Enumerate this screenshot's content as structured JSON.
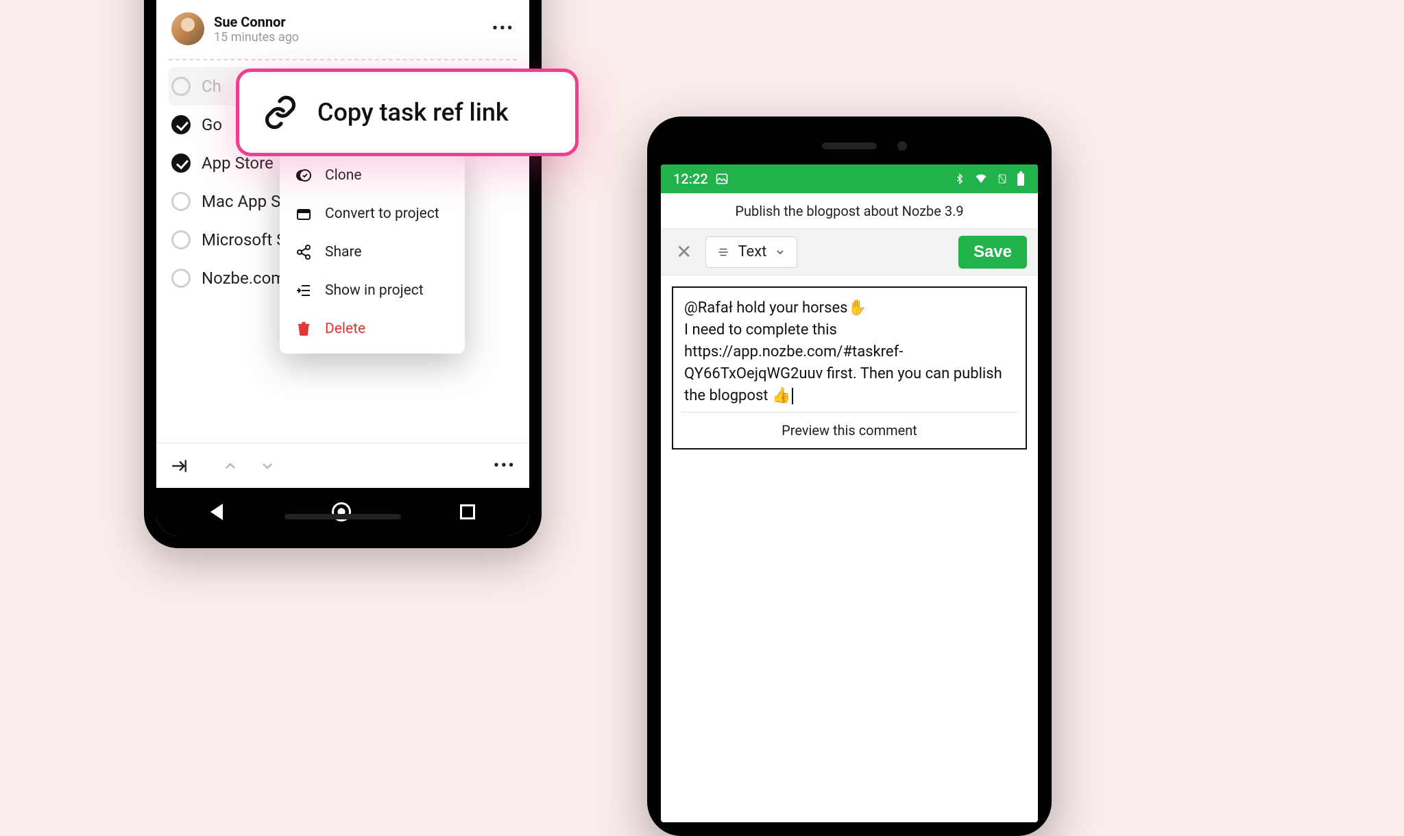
{
  "left": {
    "user": {
      "name": "Sue Connor",
      "time_ago": "15 minutes ago"
    },
    "tasks": [
      {
        "label": "Ch",
        "checked": false,
        "dim": true
      },
      {
        "label": "Go",
        "checked": true
      },
      {
        "label": "App Store",
        "checked": true
      },
      {
        "label": "Mac App Store",
        "checked": false
      },
      {
        "label": "Microsoft Store",
        "checked": false
      },
      {
        "label": "Nozbe.com",
        "checked": false
      }
    ],
    "context_menu": [
      {
        "icon": "clone-icon",
        "label": "Clone"
      },
      {
        "icon": "convert-icon",
        "label": "Convert to project"
      },
      {
        "icon": "share-icon",
        "label": "Share"
      },
      {
        "icon": "show-in-project-icon",
        "label": "Show in project"
      },
      {
        "icon": "trash-icon",
        "label": "Delete",
        "danger": true
      }
    ],
    "highlight": {
      "label": "Copy task ref link"
    }
  },
  "right": {
    "status": {
      "time": "12:22"
    },
    "title": "Publish the blogpost about Nozbe 3.9",
    "toolbar": {
      "type_label": "Text",
      "save_label": "Save"
    },
    "comment": {
      "text": "@Rafał hold your horses✋\nI need to complete this https://app.nozbe.com/#taskref-QY66TxOejqWG2uuv first. Then you can publish the blogpost 👍",
      "preview_label": "Preview this comment"
    }
  }
}
